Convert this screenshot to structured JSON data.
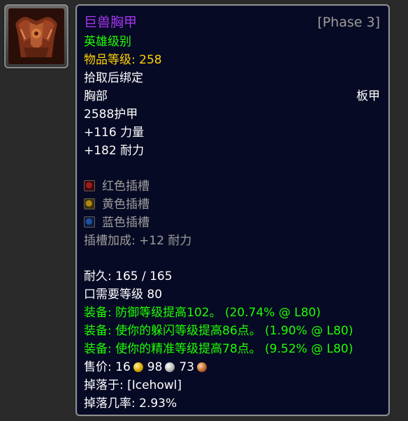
{
  "item": {
    "name": "巨兽胸甲",
    "phase": "[Phase 3]",
    "quality_label": "英雄级别",
    "item_level_label": "物品等级:",
    "item_level_value": "258",
    "bind": "拾取后绑定",
    "slot": "胸部",
    "armor_type": "板甲",
    "armor": "2588护甲",
    "stats": [
      "+116 力量",
      "+182 耐力"
    ],
    "sockets": [
      {
        "color": "red",
        "label": "红色插槽"
      },
      {
        "color": "yellow",
        "label": "黄色插槽"
      },
      {
        "color": "blue",
        "label": "蓝色插槽"
      }
    ],
    "socket_bonus": "插槽加成: +12 耐力",
    "durability": "耐久: 165 / 165",
    "required_level": "口需要等级 80",
    "equip_effects": [
      "装备: 防御等级提高102。 (20.74% @ L80)",
      "装备: 使你的躲闪等级提高86点。 (1.90% @ L80)",
      "装备: 使你的精准等级提高78点。 (9.52% @ L80)"
    ],
    "sell_price_label": "售价:",
    "sell_gold": "16",
    "sell_silver": "98",
    "sell_copper": "73",
    "drop_source": "掉落于: [Icehowl]",
    "drop_rate": "掉落几率: 2.93%"
  },
  "colors": {
    "epic": "#a335ee",
    "heroic": "#1eff00",
    "item_level": "#ffd100",
    "grey": "#9d9d9d",
    "background": "#070a24"
  },
  "icons": {
    "item": "chest-armor-icon",
    "gold": "gold-coin-icon",
    "silver": "silver-coin-icon",
    "copper": "copper-coin-icon"
  }
}
